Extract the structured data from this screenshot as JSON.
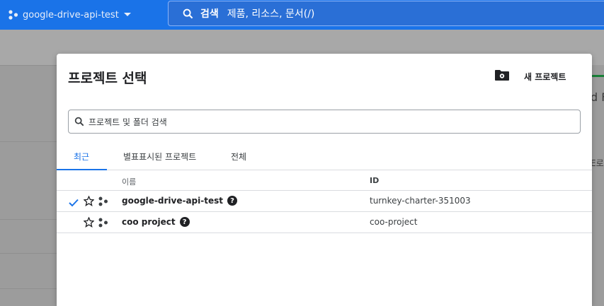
{
  "topbar": {
    "project_name": "google-drive-api-test",
    "search_label": "검색",
    "search_placeholder": "제품, 리소스, 문서(/)"
  },
  "background": {
    "right_text_1": "d F",
    "right_text_2": "E로"
  },
  "dialog": {
    "title": "프로젝트 선택",
    "new_project_label": "새 프로젝트",
    "search_placeholder": "프로젝트 및 폴더 검색",
    "tabs": [
      {
        "label": "최근",
        "active": true
      },
      {
        "label": "별표표시된 프로젝트",
        "active": false
      },
      {
        "label": "전체",
        "active": false
      }
    ],
    "table": {
      "columns": {
        "name": "이름",
        "id": "ID"
      },
      "rows": [
        {
          "name": "google-drive-api-test",
          "id": "turnkey-charter-351003",
          "selected": true
        },
        {
          "name": "coo project",
          "id": "coo-project",
          "selected": false
        }
      ]
    }
  },
  "colors": {
    "accent": "#1a73e8",
    "text": "#202124"
  }
}
